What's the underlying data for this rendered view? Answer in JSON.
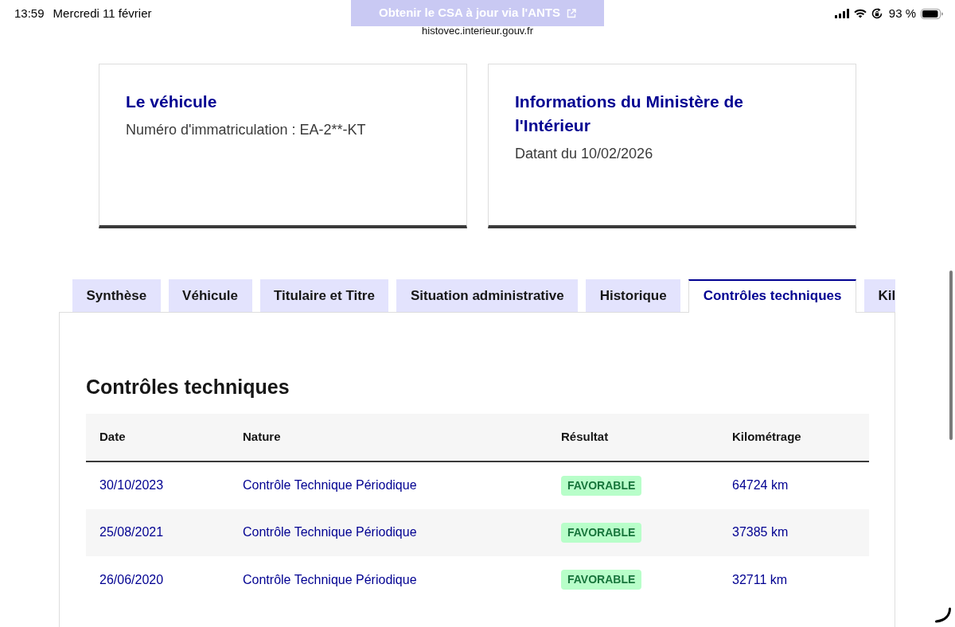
{
  "status_bar": {
    "time": "13:59",
    "date": "Mercredi 11 février",
    "battery": "93 %"
  },
  "url": "histovec.interieur.gouv.fr",
  "floating_button": {
    "label": "Obtenir le CSA à jour via l'ANTS"
  },
  "cards": [
    {
      "title": "Le véhicule",
      "text": "Numéro d'immatriculation : EA-2**-KT"
    },
    {
      "title": "Informations du Ministère de l'Intérieur",
      "text": "Datant du 10/02/2026"
    }
  ],
  "tabs": [
    {
      "label": "Synthèse",
      "selected": false
    },
    {
      "label": "Véhicule",
      "selected": false
    },
    {
      "label": "Titulaire et Titre",
      "selected": false
    },
    {
      "label": "Situation administrative",
      "selected": false
    },
    {
      "label": "Historique",
      "selected": false
    },
    {
      "label": "Contrôles techniques",
      "selected": true
    },
    {
      "label": "Kil",
      "selected": false
    }
  ],
  "section": {
    "title": "Contrôles techniques",
    "table": {
      "columns": [
        "Date",
        "Nature",
        "Résultat",
        "Kilométrage"
      ],
      "rows": [
        {
          "date": "30/10/2023",
          "nature": "Contrôle Technique Périodique",
          "result": "FAVORABLE",
          "mileage": "64724 km"
        },
        {
          "date": "25/08/2021",
          "nature": "Contrôle Technique Périodique",
          "result": "FAVORABLE",
          "mileage": "37385 km"
        },
        {
          "date": "26/06/2020",
          "nature": "Contrôle Technique Périodique",
          "result": "FAVORABLE",
          "mileage": "32711 km"
        }
      ]
    }
  }
}
